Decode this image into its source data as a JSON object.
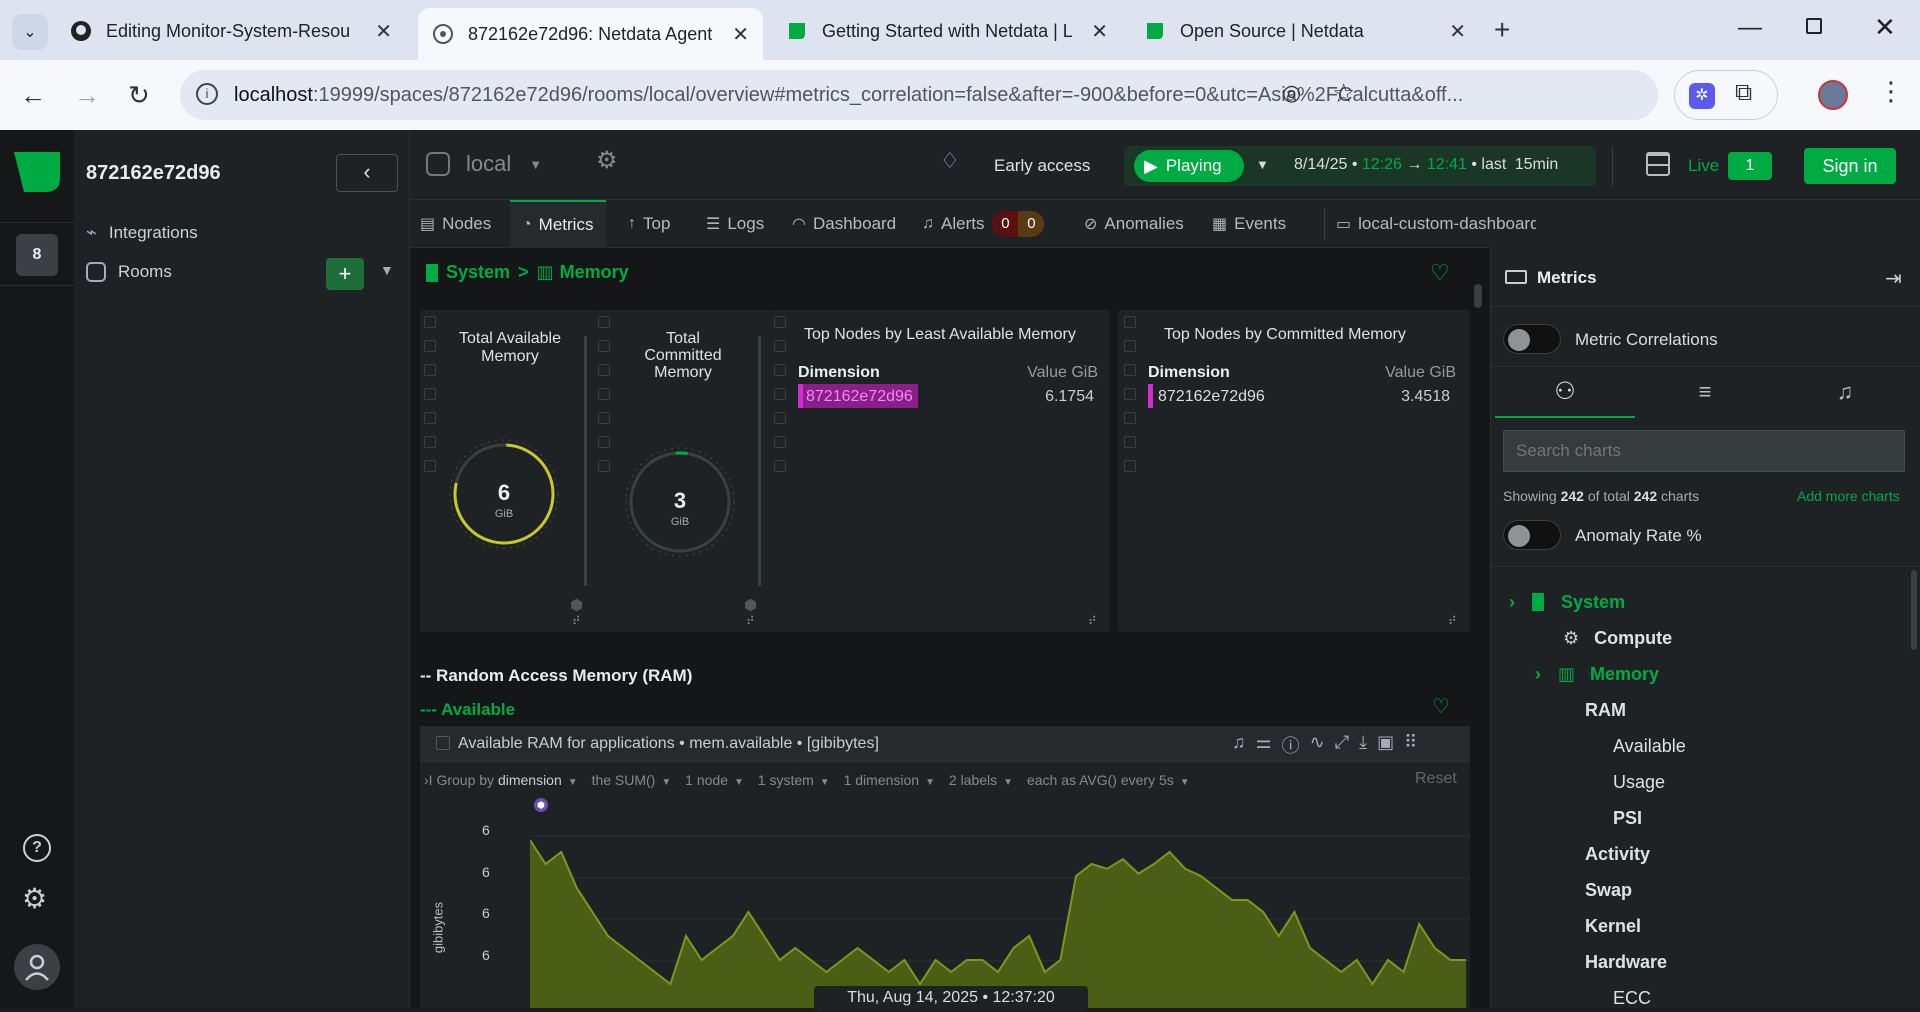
{
  "browser": {
    "tabs": [
      {
        "title": "Editing Monitor-System-Resour",
        "icon": "github-icon"
      },
      {
        "title": "872162e72d96: Netdata Agent",
        "icon": "netdata-agent-icon"
      },
      {
        "title": "Getting Started with Netdata | L",
        "icon": "netdata-leaf-icon"
      },
      {
        "title": "Open Source | Netdata",
        "icon": "netdata-leaf-icon"
      }
    ],
    "url_host": "localhost",
    "url_rest": ":19999/spaces/872162e72d96/rooms/local/overview#metrics_correlation=false&after=-900&before=0&utc=Asia%2FCalcutta&off..."
  },
  "rail": {
    "space_badge": "8"
  },
  "sidebar": {
    "space_name": "872162e72d96",
    "integrations": "Integrations",
    "rooms": "Rooms",
    "add_label": "+"
  },
  "topbar": {
    "room": "local",
    "early_access": "Early access",
    "playing": "Playing",
    "date": "8/14/25 •",
    "time_from": "12:26",
    "arrow": "→",
    "time_to": "12:41",
    "last": "• last",
    "duration": "15min",
    "live": "Live",
    "live_count": "1",
    "sign_in": "Sign in"
  },
  "tabs": {
    "nodes": "Nodes",
    "metrics": "Metrics",
    "top": "Top",
    "logs": "Logs",
    "dashboard": "Dashboard",
    "alerts": "Alerts",
    "alerts_critical": "0",
    "alerts_warning": "0",
    "anomalies": "Anomalies",
    "events": "Events",
    "custom": "local-custom-dashboard"
  },
  "content": {
    "breadcrumb_system": "System",
    "breadcrumb_sep": ">",
    "breadcrumb_memory": "Memory",
    "card1_title": "Total Available Memory",
    "card1_value": "6",
    "card1_unit": "GiB",
    "card2_title": "Total Committed Memory",
    "card2_value": "3",
    "card2_unit": "GiB",
    "card3_title": "Top Nodes by Least Available Memory",
    "card3_col1": "Dimension",
    "card3_col2": "Value GiB",
    "card3_node": "872162e72d96",
    "card3_value": "6.1754",
    "card4_title": "Top Nodes by Committed Memory",
    "card4_col1": "Dimension",
    "card4_col2": "Value GiB",
    "card4_node": "872162e72d96",
    "card4_value": "3.4518",
    "section_ram": "-- Random Access Memory (RAM)",
    "section_available": "--- Available",
    "chart_title": "Available RAM for applications • mem.available • [gibibytes]",
    "group_prefix": "Group by",
    "group_by": "dimension",
    "agg": "the SUM()",
    "nodes": "1 node",
    "system": "1 system",
    "dimension": "1 dimension",
    "labels": "2 labels",
    "each_as": "each as AVG() every 5s",
    "reset": "Reset",
    "y_label": "gibibytes",
    "y_ticks": [
      "6",
      "6",
      "6",
      "6"
    ],
    "timestamp": "Thu, Aug 14, 2025 • 12:37:20"
  },
  "chart_data": {
    "type": "area",
    "title": "Available RAM for applications • mem.available • [gibibytes]",
    "ylabel": "gibibytes",
    "series": [
      {
        "name": "available",
        "color": "#7a9a1e",
        "values": [
          6.19,
          6.18,
          6.185,
          6.17,
          6.16,
          6.15,
          6.145,
          6.14,
          6.135,
          6.13,
          6.15,
          6.14,
          6.145,
          6.15,
          6.16,
          6.15,
          6.14,
          6.145,
          6.14,
          6.135,
          6.14,
          6.145,
          6.14,
          6.135,
          6.14,
          6.13,
          6.14,
          6.135,
          6.14,
          6.14,
          6.135,
          6.145,
          6.15,
          6.135,
          6.14,
          6.175,
          6.18,
          6.178,
          6.182,
          6.176,
          6.18,
          6.185,
          6.178,
          6.175,
          6.17,
          6.165,
          6.165,
          6.16,
          6.15,
          6.16,
          6.145,
          6.14,
          6.135,
          6.14,
          6.13,
          6.14,
          6.135,
          6.155,
          6.145,
          6.14,
          6.14
        ]
      }
    ]
  },
  "rpanel": {
    "title": "Metrics",
    "metric_correlations": "Metric Correlations",
    "search_placeholder": "Search charts",
    "showing_prefix": "Showing",
    "showing_count": "242",
    "showing_mid": "of total",
    "showing_total": "242",
    "showing_suffix": "charts",
    "add_more": "Add more charts",
    "anomaly_rate": "Anomaly Rate %",
    "tree": {
      "system": "System",
      "compute": "Compute",
      "memory": "Memory",
      "ram": "RAM",
      "available": "Available",
      "usage": "Usage",
      "psi": "PSI",
      "activity": "Activity",
      "swap": "Swap",
      "kernel": "Kernel",
      "hardware": "Hardware",
      "ecc": "ECC"
    }
  },
  "colors": {
    "accent": "#00ab44",
    "magenta": "#d42bd4",
    "gauge_yellow": "#c8c82a"
  }
}
